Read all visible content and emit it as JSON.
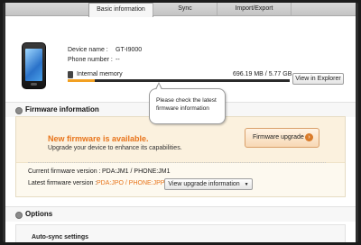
{
  "tabs": [
    {
      "label": "Basic information",
      "active": true
    },
    {
      "label": "Sync",
      "active": false
    },
    {
      "label": "Import/Export",
      "active": false
    }
  ],
  "device": {
    "name_label": "Device name :",
    "name_value": "GT-I9000",
    "phone_label": "Phone number :",
    "phone_value": "--"
  },
  "memory": {
    "label": "Internal memory",
    "usage_text": "696.19 MB / 5.77 GB",
    "used_fraction": 0.12,
    "explorer_button": "View in Explorer"
  },
  "tooltip": {
    "text": "Please check the latest firmware information"
  },
  "firmware": {
    "section_title": "Firmware information",
    "headline": "New firmware is available.",
    "subtext": "Upgrade your device to enhance its capabilities.",
    "upgrade_button": "Firmware upgrade",
    "current_label": "Current firmware version :",
    "current_value": "PDA:JM1 / PHONE:JM1",
    "latest_label": "Latest firmware version :",
    "latest_value": "PDA:JPO / PHONE:JPP",
    "view_info_button": "View upgrade information"
  },
  "options": {
    "section_title": "Options",
    "auto_sync": "Auto-sync settings"
  },
  "colors": {
    "accent_orange": "#e8741a",
    "memory_fill": "#f2a022"
  }
}
